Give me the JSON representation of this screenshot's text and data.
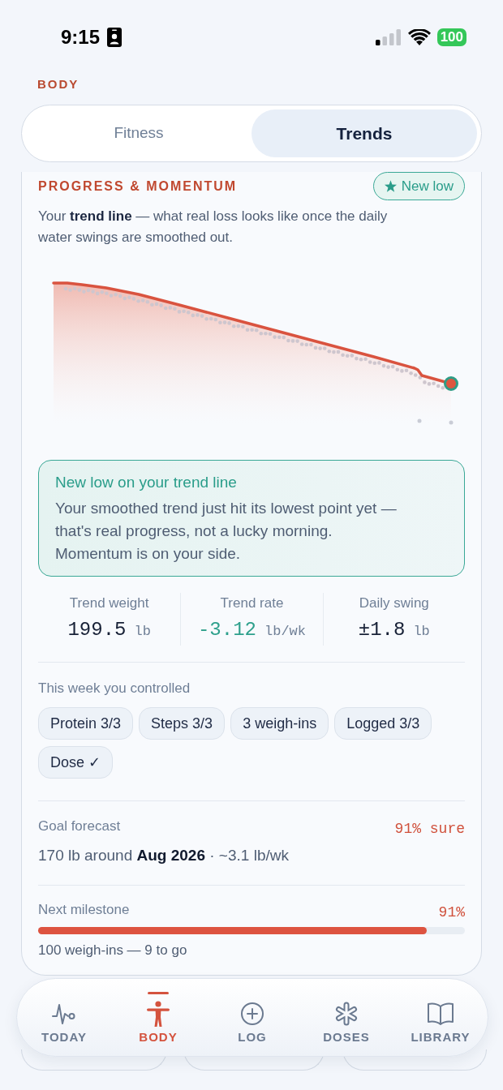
{
  "status_bar": {
    "time": "9:15",
    "battery": "100"
  },
  "header": {
    "title": "BODY"
  },
  "tabs": [
    {
      "label": "Fitness",
      "selected": false
    },
    {
      "label": "Trends",
      "selected": true
    }
  ],
  "card": {
    "title": "PROGRESS & MOMENTUM",
    "badge": "New low",
    "description": "Your **trend line** — what real loss looks like once the daily water swings are smoothed out.",
    "callout": {
      "title": "New low on your trend line",
      "body": "Your smoothed trend just hit its lowest point yet — that's real progress, not a lucky morning. Momentum is on your side."
    },
    "stats": [
      {
        "label": "Trend weight",
        "value": "199.5",
        "unit": "lb",
        "kind": "plain"
      },
      {
        "label": "Trend rate",
        "value": "-3.12",
        "unit": "lb/wk",
        "kind": "highlight"
      },
      {
        "label": "Daily swing",
        "value": "±1.8",
        "unit": "lb",
        "kind": "plain"
      }
    ],
    "week": {
      "heading": "This week you controlled",
      "chips": [
        "Protein 3/3",
        "Steps 3/3",
        "3 weigh-ins",
        "Logged 3/3",
        "Dose ✓"
      ]
    },
    "forecast": {
      "label": "Goal forecast",
      "confidence": "91% sure",
      "summary": "170 lb around **Aug 2026** · ~3.1 lb/wk"
    },
    "milestone": {
      "label": "Next milestone",
      "percent": "91%",
      "level": 0.91,
      "caption": "100 weigh-ins — 9 to go"
    }
  },
  "nav": [
    {
      "label": "TODAY",
      "selected": false
    },
    {
      "label": "BODY",
      "selected": true
    },
    {
      "label": "LOG",
      "selected": false
    },
    {
      "label": "DOSES",
      "selected": false
    },
    {
      "label": "LIBRARY",
      "selected": false
    }
  ]
}
